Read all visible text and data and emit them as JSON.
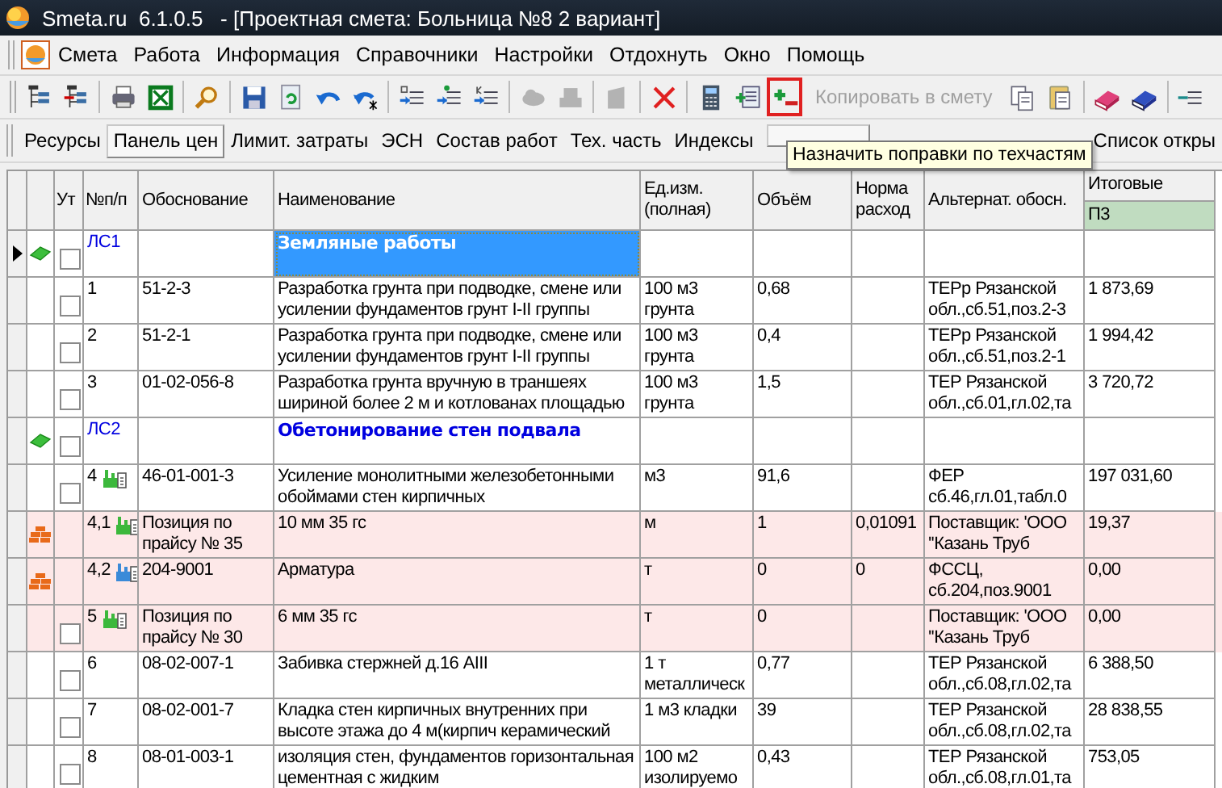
{
  "window": {
    "title": "Smeta.ru  6.1.0.5   - [Проектная смета: Больница №8 2 вариант]"
  },
  "menu": [
    "Смета",
    "Работа",
    "Информация",
    "Справочники",
    "Настройки",
    "Отдохнуть",
    "Окно",
    "Помощь"
  ],
  "toolbar": [
    {
      "kind": "tree-add",
      "highlighted": false,
      "disabled": false
    },
    {
      "kind": "tree-remove",
      "highlighted": false,
      "disabled": false
    },
    {
      "kind": "sep"
    },
    {
      "kind": "printer",
      "highlighted": false,
      "disabled": false
    },
    {
      "kind": "spreadsheet",
      "highlighted": false,
      "disabled": false
    },
    {
      "kind": "sep"
    },
    {
      "kind": "magnifier",
      "highlighted": false,
      "disabled": false
    },
    {
      "kind": "sep"
    },
    {
      "kind": "save",
      "highlighted": false,
      "disabled": false
    },
    {
      "kind": "refresh",
      "highlighted": false,
      "disabled": false
    },
    {
      "kind": "undo",
      "highlighted": false,
      "disabled": false
    },
    {
      "kind": "redo",
      "highlighted": false,
      "disabled": false
    },
    {
      "kind": "sep"
    },
    {
      "kind": "list-c",
      "highlighted": false,
      "disabled": false
    },
    {
      "kind": "list-dot",
      "highlighted": false,
      "disabled": false
    },
    {
      "kind": "list-k",
      "highlighted": false,
      "disabled": false
    },
    {
      "kind": "sep"
    },
    {
      "kind": "cloud",
      "highlighted": false,
      "disabled": true
    },
    {
      "kind": "block",
      "highlighted": false,
      "disabled": true
    },
    {
      "kind": "sep"
    },
    {
      "kind": "page",
      "highlighted": false,
      "disabled": true
    },
    {
      "kind": "sep"
    },
    {
      "kind": "delete",
      "highlighted": false,
      "disabled": false
    },
    {
      "kind": "sep"
    },
    {
      "kind": "calculator",
      "highlighted": false,
      "disabled": false
    },
    {
      "kind": "table-minus",
      "highlighted": false,
      "disabled": false
    },
    {
      "kind": "plus-minus",
      "highlighted": true,
      "disabled": false
    },
    {
      "kind": "text",
      "label": "Копировать в смету",
      "highlighted": false,
      "disabled": true
    },
    {
      "kind": "copy",
      "highlighted": false,
      "disabled": false
    },
    {
      "kind": "paste",
      "highlighted": false,
      "disabled": false
    },
    {
      "kind": "sep"
    },
    {
      "kind": "book-pink",
      "highlighted": false,
      "disabled": false
    },
    {
      "kind": "book-blue",
      "highlighted": false,
      "disabled": false
    },
    {
      "kind": "sep"
    },
    {
      "kind": "arrow-list",
      "highlighted": false,
      "disabled": false
    }
  ],
  "tabs": [
    {
      "label": "Ресурсы",
      "selected": false
    },
    {
      "label": "Панель цен",
      "selected": true
    },
    {
      "label": "Лимит. затраты",
      "selected": false
    },
    {
      "label": "ЭСН",
      "selected": false
    },
    {
      "label": "Состав работ",
      "selected": false
    },
    {
      "label": "Тех. часть",
      "selected": false
    },
    {
      "label": "Индексы",
      "selected": false
    },
    {
      "selected": true
    },
    {
      "label": "Список откры",
      "selected": false
    }
  ],
  "tooltip": "Назначить поправки по техчастям",
  "table": {
    "columns": [
      "Ут",
      "№п/п",
      "Обоснование",
      "Наименование",
      "Ед.изм. (полная)",
      "Объём",
      "Норма расход",
      "Альтернат. обосн.",
      "Итоговые"
    ],
    "subcolumn": "П3",
    "rows": [
      {
        "kind": "section",
        "selected": true,
        "row_icon": {
          "kind": "section"
        },
        "checked": false,
        "num": "ЛС1",
        "code": "",
        "name": "Земляные работы",
        "focused": true,
        "unit": "",
        "volume": "",
        "norm": "",
        "alt": "",
        "total": "",
        "tinted": false
      },
      {
        "kind": "item",
        "selected": false,
        "checked": false,
        "num": "1",
        "code": "51-2-3",
        "name": "Разработка грунта при подводке, смене или усилении фундаментов грунт I-II группы",
        "focused": false,
        "unit": "100 м3 грунта",
        "volume": "0,68",
        "norm": "",
        "alt": "ТЕРр Рязанской обл.,сб.51,поз.2-3",
        "total": "1 873,69",
        "tinted": false
      },
      {
        "kind": "item",
        "selected": false,
        "checked": false,
        "num": "2",
        "code": "51-2-1",
        "name": "Разработка грунта при подводке, смене или усилении фундаментов грунт I-II группы",
        "focused": false,
        "unit": "100 м3 грунта",
        "volume": "0,4",
        "norm": "",
        "alt": "ТЕРр Рязанской обл.,сб.51,поз.2-1",
        "total": "1 994,42",
        "tinted": false
      },
      {
        "kind": "item",
        "selected": false,
        "checked": false,
        "num": "3",
        "code": "01-02-056-8",
        "name": "Разработка грунта вручную в траншеях шириной более 2 м и котлованах площадью",
        "focused": false,
        "unit": "100 м3 грунта",
        "volume": "1,5",
        "norm": "",
        "alt": "ТЕР Рязанской обл.,сб.01,гл.02,та",
        "total": "3 720,72",
        "tinted": false
      },
      {
        "kind": "section",
        "selected": false,
        "row_icon": {
          "kind": "section"
        },
        "checked": false,
        "num": "ЛС2",
        "code": "",
        "name": "Обетонирование стен подвала",
        "focused": false,
        "unit": "",
        "volume": "",
        "norm": "",
        "alt": "",
        "total": "",
        "tinted": false
      },
      {
        "kind": "item",
        "selected": false,
        "checked": false,
        "num": "4",
        "res_icon": {
          "kind": "machine",
          "color": "#3cb83c"
        },
        "code": "46-01-001-3",
        "name": "Усиление монолитными железобетонными обоймами стен кирпичных",
        "focused": false,
        "unit": "м3",
        "volume": "91,6",
        "norm": "",
        "alt": "ФЕР сб.46,гл.01,табл.0",
        "total": "197 031,60",
        "tinted": false
      },
      {
        "kind": "item",
        "selected": false,
        "row_icon": {
          "kind": "bricks"
        },
        "num": "4,1",
        "res_icon": {
          "kind": "machine",
          "color": "#3cb83c"
        },
        "code": "Позиция по прайсу № 35",
        "name": "10 мм 35 гс",
        "focused": false,
        "unit": "м",
        "volume": "1",
        "norm": "0,01091",
        "alt": "Поставщик: 'ООО ''Казань Труб",
        "total": "19,37",
        "tinted": true
      },
      {
        "kind": "item",
        "selected": false,
        "row_icon": {
          "kind": "bricks"
        },
        "num": "4,2",
        "res_icon": {
          "kind": "machine",
          "color": "#3a8ad8"
        },
        "code": "204-9001",
        "name": "Арматура",
        "focused": false,
        "unit": "т",
        "volume": "0",
        "norm": "0",
        "alt": "ФССЦ, сб.204,поз.9001",
        "total": "0,00",
        "tinted": true
      },
      {
        "kind": "item",
        "selected": false,
        "checked": false,
        "num": "5",
        "res_icon": {
          "kind": "machine",
          "color": "#3cb83c"
        },
        "code": "Позиция по прайсу № 30",
        "name": "6 мм 35 гс",
        "focused": false,
        "unit": "т",
        "volume": "0",
        "norm": "",
        "alt": "Поставщик: 'ООО ''Казань Труб",
        "total": "0,00",
        "tinted": true
      },
      {
        "kind": "item",
        "selected": false,
        "checked": false,
        "num": "6",
        "code": "08-02-007-1",
        "name": "Забивка стержней д.16 AIII",
        "focused": false,
        "unit": "1 т металлическ",
        "volume": "0,77",
        "norm": "",
        "alt": "ТЕР Рязанской обл.,сб.08,гл.02,та",
        "total": "6 388,50",
        "tinted": false
      },
      {
        "kind": "item",
        "selected": false,
        "checked": false,
        "num": "7",
        "code": "08-02-001-7",
        "name": "Кладка стен кирпичных внутренних при высоте этажа до 4 м(кирпич керамический",
        "focused": false,
        "unit": "1 м3 кладки",
        "volume": "39",
        "norm": "",
        "alt": "ТЕР Рязанской обл.,сб.08,гл.02,та",
        "total": "28 838,55",
        "tinted": false
      },
      {
        "kind": "item",
        "selected": false,
        "checked": false,
        "num": "8",
        "code": "08-01-003-1",
        "name": "изоляция стен, фундаментов горизонтальная цементная с жидким",
        "focused": false,
        "unit": "100 м2 изолируемо",
        "volume": "0,43",
        "norm": "",
        "alt": "ТЕР Рязанской обл.,сб.08,гл.01,та",
        "total": "753,05",
        "tinted": false
      }
    ]
  }
}
